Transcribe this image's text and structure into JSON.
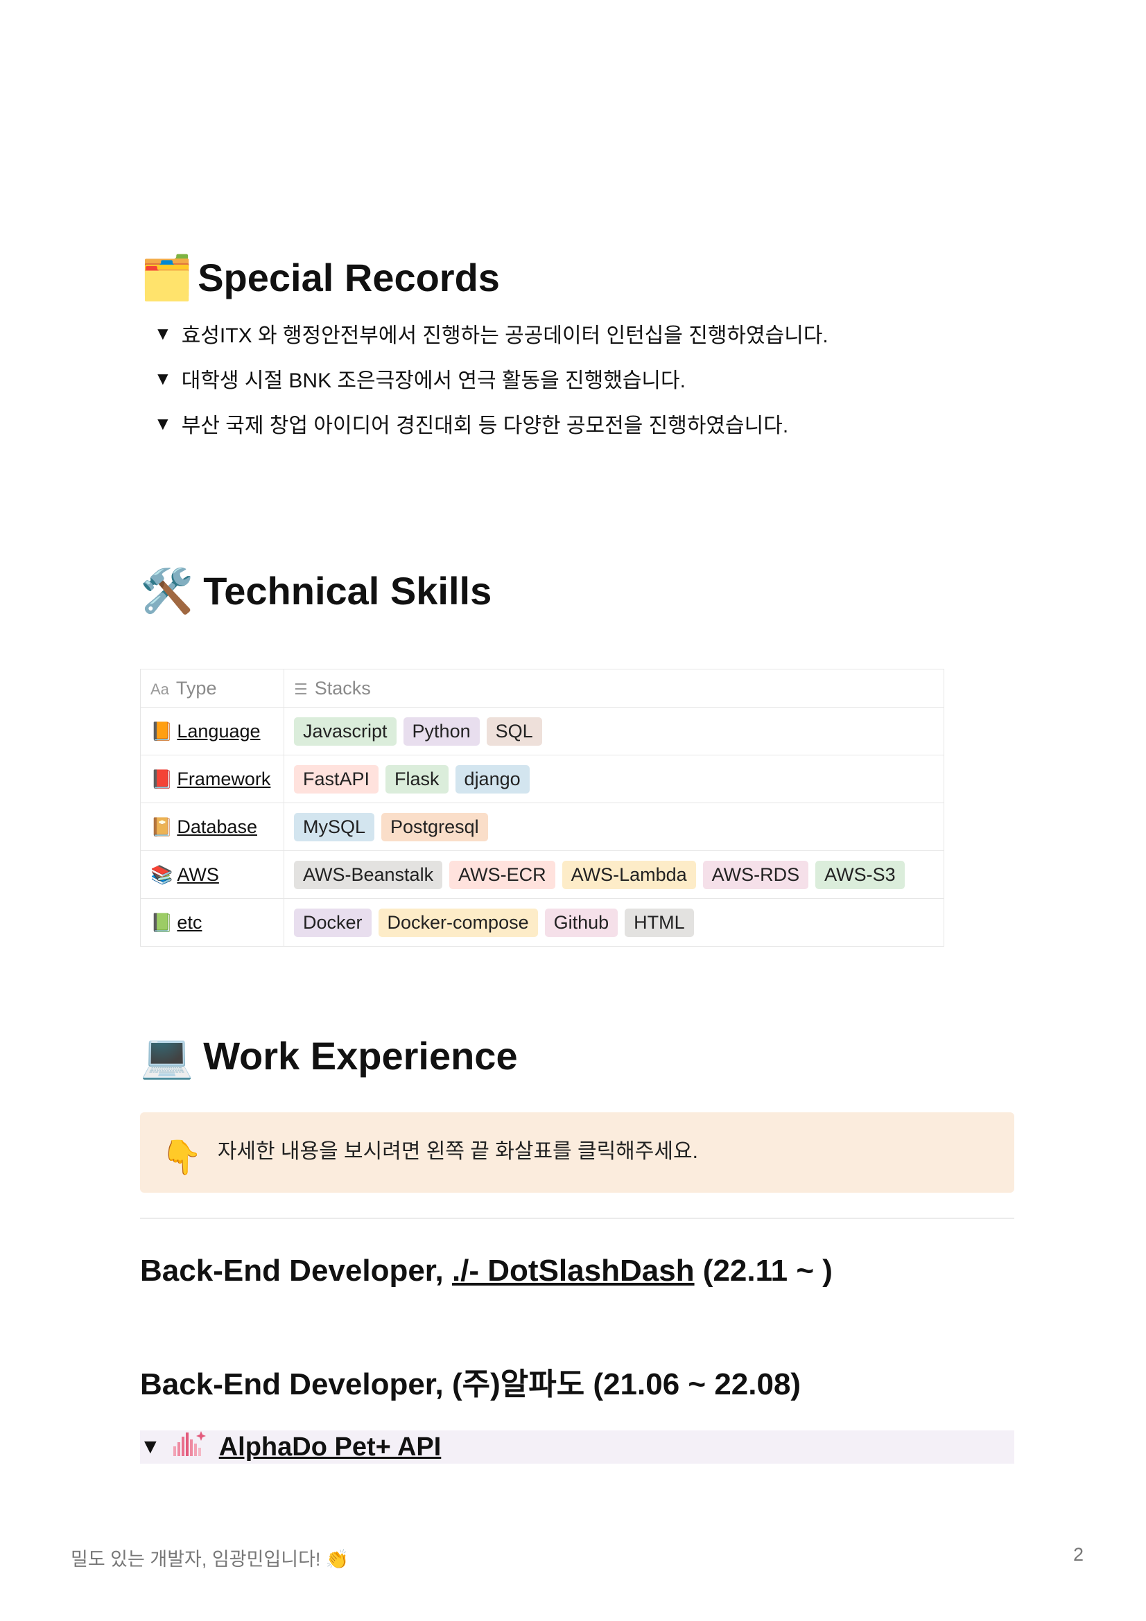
{
  "special_records": {
    "icon": "card-index-dividers-icon",
    "title": "Special Records",
    "items": [
      "효성ITX 와 행정안전부에서 진행하는 공공데이터 인턴십을 진행하였습니다.",
      "대학생 시절 BNK 조은극장에서 연극 활동을 진행했습니다.",
      "부산 국제 창업 아이디어 경진대회 등 다양한 공모전을 진행하였습니다."
    ]
  },
  "technical_skills": {
    "icon": "hammer-and-wrench-icon",
    "title": "Technical Skills",
    "table": {
      "headers": {
        "type_icon": "Aa",
        "type": "Type",
        "stacks": "Stacks"
      },
      "rows": [
        {
          "emoji": "📙",
          "type": "Language",
          "stacks": [
            {
              "label": "Javascript",
              "color": "#dbeddb"
            },
            {
              "label": "Python",
              "color": "#e8deee"
            },
            {
              "label": "SQL",
              "color": "#eee0da"
            }
          ]
        },
        {
          "emoji": "📕",
          "type": "Framework",
          "stacks": [
            {
              "label": "FastAPI",
              "color": "#ffe2dd"
            },
            {
              "label": "Flask",
              "color": "#dbeddb"
            },
            {
              "label": "django",
              "color": "#d3e5ef"
            }
          ]
        },
        {
          "emoji": "📔",
          "type": "Database",
          "stacks": [
            {
              "label": "MySQL",
              "color": "#d3e5ef"
            },
            {
              "label": "Postgresql",
              "color": "#fadec9"
            }
          ]
        },
        {
          "emoji": "📚",
          "type": "AWS",
          "stacks": [
            {
              "label": "AWS-Beanstalk",
              "color": "#e3e2e0"
            },
            {
              "label": "AWS-ECR",
              "color": "#ffe2dd"
            },
            {
              "label": "AWS-Lambda",
              "color": "#fdecc8"
            },
            {
              "label": "AWS-RDS",
              "color": "#f5e0e9"
            },
            {
              "label": "AWS-S3",
              "color": "#dbeddb"
            }
          ]
        },
        {
          "emoji": "📗",
          "type": "etc",
          "stacks": [
            {
              "label": "Docker",
              "color": "#e8deee"
            },
            {
              "label": "Docker-compose",
              "color": "#fdecc8"
            },
            {
              "label": "Github",
              "color": "#f5e0e9"
            },
            {
              "label": "HTML",
              "color": "#e3e2e0"
            }
          ]
        }
      ]
    }
  },
  "work_experience": {
    "icon": "laptop-icon",
    "title": "Work Experience",
    "callout": {
      "icon": "pointing-down-icon",
      "text": "자세한 내용을 보시려면 왼쪽 끝 화살표를 클릭해주세요."
    },
    "jobs": [
      {
        "prefix": "Back-End Developer, ",
        "company": "./- DotSlashDash",
        "period": " (22.11 ~ )"
      },
      {
        "prefix": "Back-End Developer, ",
        "company": "(주)알파도",
        "period": " (21.06 ~ 22.08)"
      }
    ],
    "project": {
      "icon": "bar-chart-sparkle-icon",
      "name": "AlphaDo Pet+ API"
    }
  },
  "footer": {
    "left": "밀도 있는 개발자, 임광민입니다! 👏",
    "page": "2"
  }
}
